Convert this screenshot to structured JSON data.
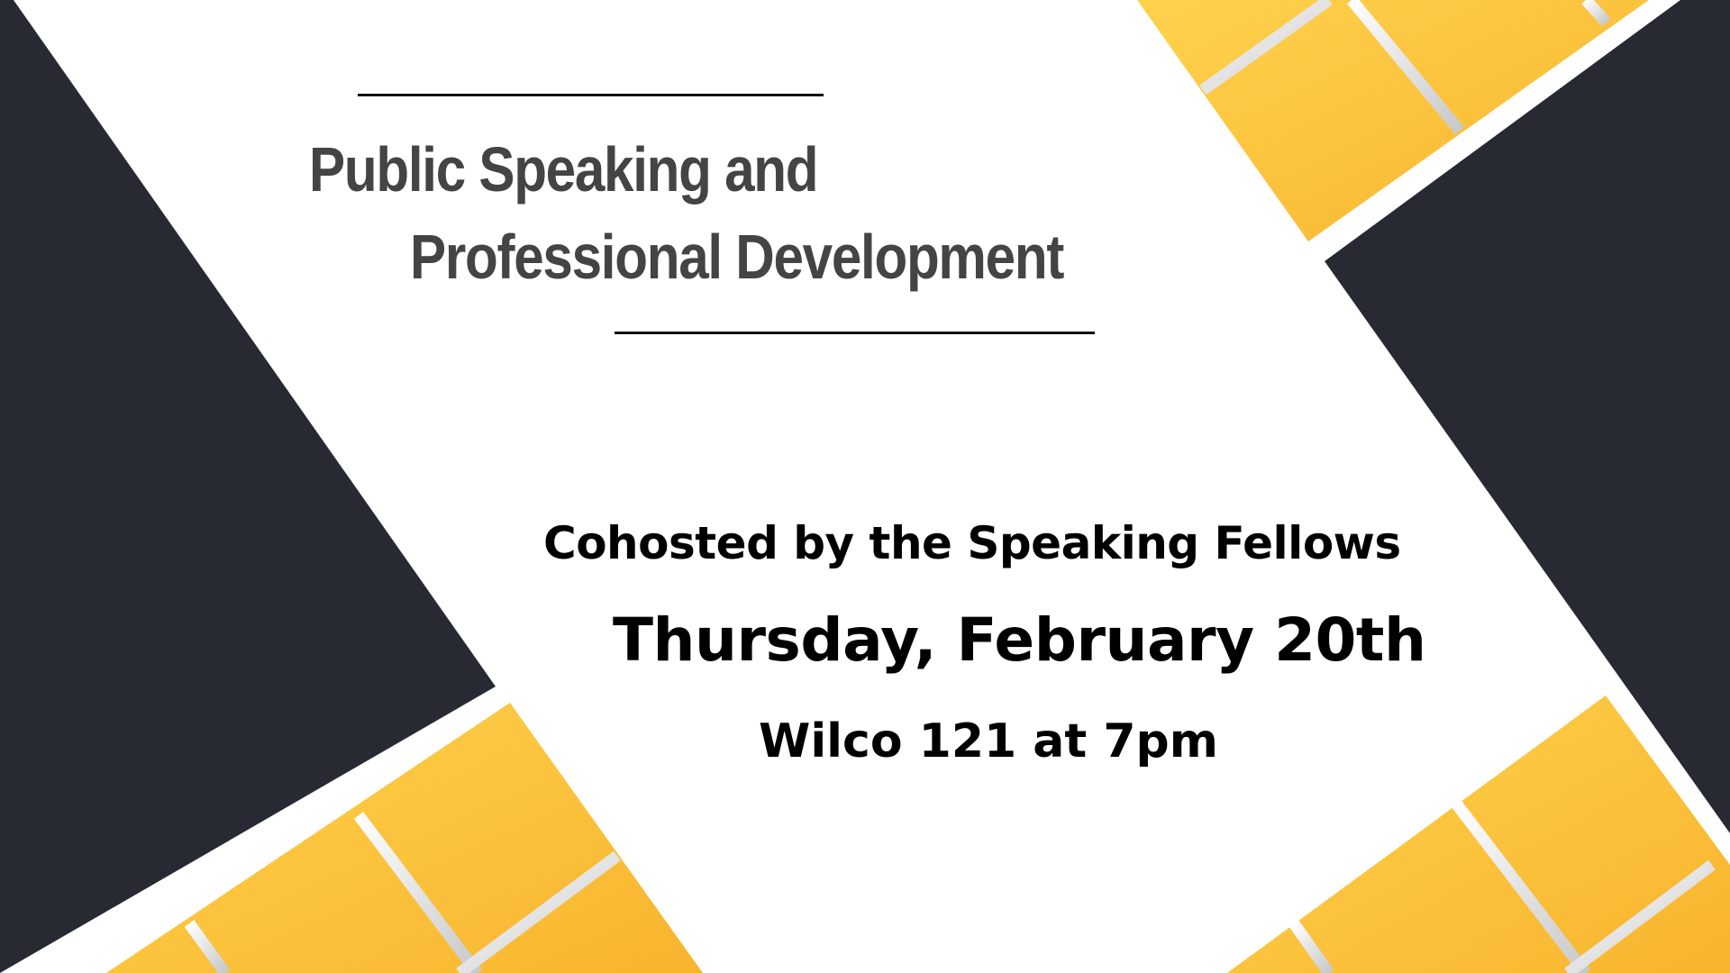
{
  "title": {
    "line1": "Public Speaking and",
    "line2": "Professional Development"
  },
  "details": {
    "cohost": "Cohosted by the Speaking Fellows",
    "date": "Thursday, February 20th",
    "location": "Wilco 121 at 7pm"
  },
  "colors": {
    "dark": "#272a33",
    "gold": "#fbbb32",
    "gold_light": "#ffd24d",
    "title_text": "#444444",
    "body_text": "#000000"
  }
}
